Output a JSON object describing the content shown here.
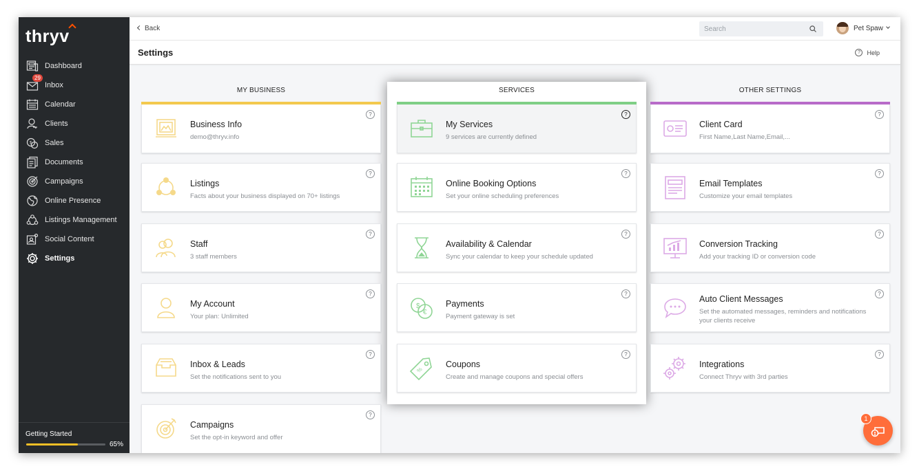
{
  "app": {
    "logo_text": "thryv"
  },
  "sidebar": {
    "items": [
      {
        "label": "Dashboard",
        "icon": "dashboard-icon"
      },
      {
        "label": "Inbox",
        "icon": "inbox-icon",
        "badge": "29"
      },
      {
        "label": "Calendar",
        "icon": "calendar-icon"
      },
      {
        "label": "Clients",
        "icon": "clients-icon"
      },
      {
        "label": "Sales",
        "icon": "sales-icon"
      },
      {
        "label": "Documents",
        "icon": "documents-icon"
      },
      {
        "label": "Campaigns",
        "icon": "campaigns-icon"
      },
      {
        "label": "Online Presence",
        "icon": "globe-icon"
      },
      {
        "label": "Listings Management",
        "icon": "listings-icon"
      },
      {
        "label": "Social Content",
        "icon": "social-content-icon"
      },
      {
        "label": "Settings",
        "icon": "gear-icon",
        "active": true
      }
    ],
    "getting_started": {
      "label": "Getting Started",
      "percent_label": "65%",
      "progress": 0.65
    }
  },
  "header": {
    "back_label": "Back",
    "search_placeholder": "Search",
    "user_name": "Pet Spaw"
  },
  "page": {
    "title": "Settings",
    "help_label": "Help"
  },
  "columns": [
    {
      "heading": "MY BUSINESS",
      "accent": "#f3c94e",
      "icon_color": "#f5d98a",
      "cards": [
        {
          "title": "Business Info",
          "desc": "demo@thryv.info",
          "icon": "business-info-icon"
        },
        {
          "title": "Listings",
          "desc": "Facts about your business displayed on 70+ listings",
          "icon": "listings-icon"
        },
        {
          "title": "Staff",
          "desc": "3 staff members",
          "icon": "staff-icon"
        },
        {
          "title": "My Account",
          "desc": "Your plan: Unlimited",
          "icon": "account-icon"
        },
        {
          "title": "Inbox & Leads",
          "desc": "Set the notifications sent to you",
          "icon": "inbox-tray-icon"
        },
        {
          "title": "Campaigns",
          "desc": "Set the opt-in keyword and offer",
          "icon": "target-icon"
        }
      ]
    },
    {
      "heading": "SERVICES",
      "accent": "#7fcf86",
      "icon_color": "#8fd595",
      "cards": [
        {
          "title": "My Services",
          "desc": "9 services are currently defined",
          "icon": "briefcase-icon"
        },
        {
          "title": "Online Booking Options",
          "desc": "Set your online scheduling preferences",
          "icon": "calendar-grid-icon"
        },
        {
          "title": "Availability & Calendar",
          "desc": "Sync your calendar to keep your schedule updated",
          "icon": "hourglass-icon"
        },
        {
          "title": "Payments",
          "desc": "Payment gateway is set",
          "icon": "coins-icon"
        },
        {
          "title": "Coupons",
          "desc": "Create and manage coupons and special offers",
          "icon": "coupon-tag-icon"
        }
      ]
    },
    {
      "heading": "OTHER SETTINGS",
      "accent": "#b86bc9",
      "icon_color": "#dca9e6",
      "cards": [
        {
          "title": "Client Card",
          "desc": "First Name,Last Name,Email,...",
          "icon": "client-card-icon"
        },
        {
          "title": "Email Templates",
          "desc": "Customize your email templates",
          "icon": "email-template-icon"
        },
        {
          "title": "Conversion Tracking",
          "desc": "Add your tracking ID or conversion code",
          "icon": "monitor-chart-icon"
        },
        {
          "title": "Auto Client Messages",
          "desc": "Set the automated messages, reminders and notifications your clients receive",
          "icon": "chat-bubble-icon"
        },
        {
          "title": "Integrations",
          "desc": "Connect Thryv with 3rd parties",
          "icon": "gears-icon"
        }
      ]
    }
  ],
  "help_glyph": "?",
  "chat_widget": {
    "badge": "1"
  }
}
